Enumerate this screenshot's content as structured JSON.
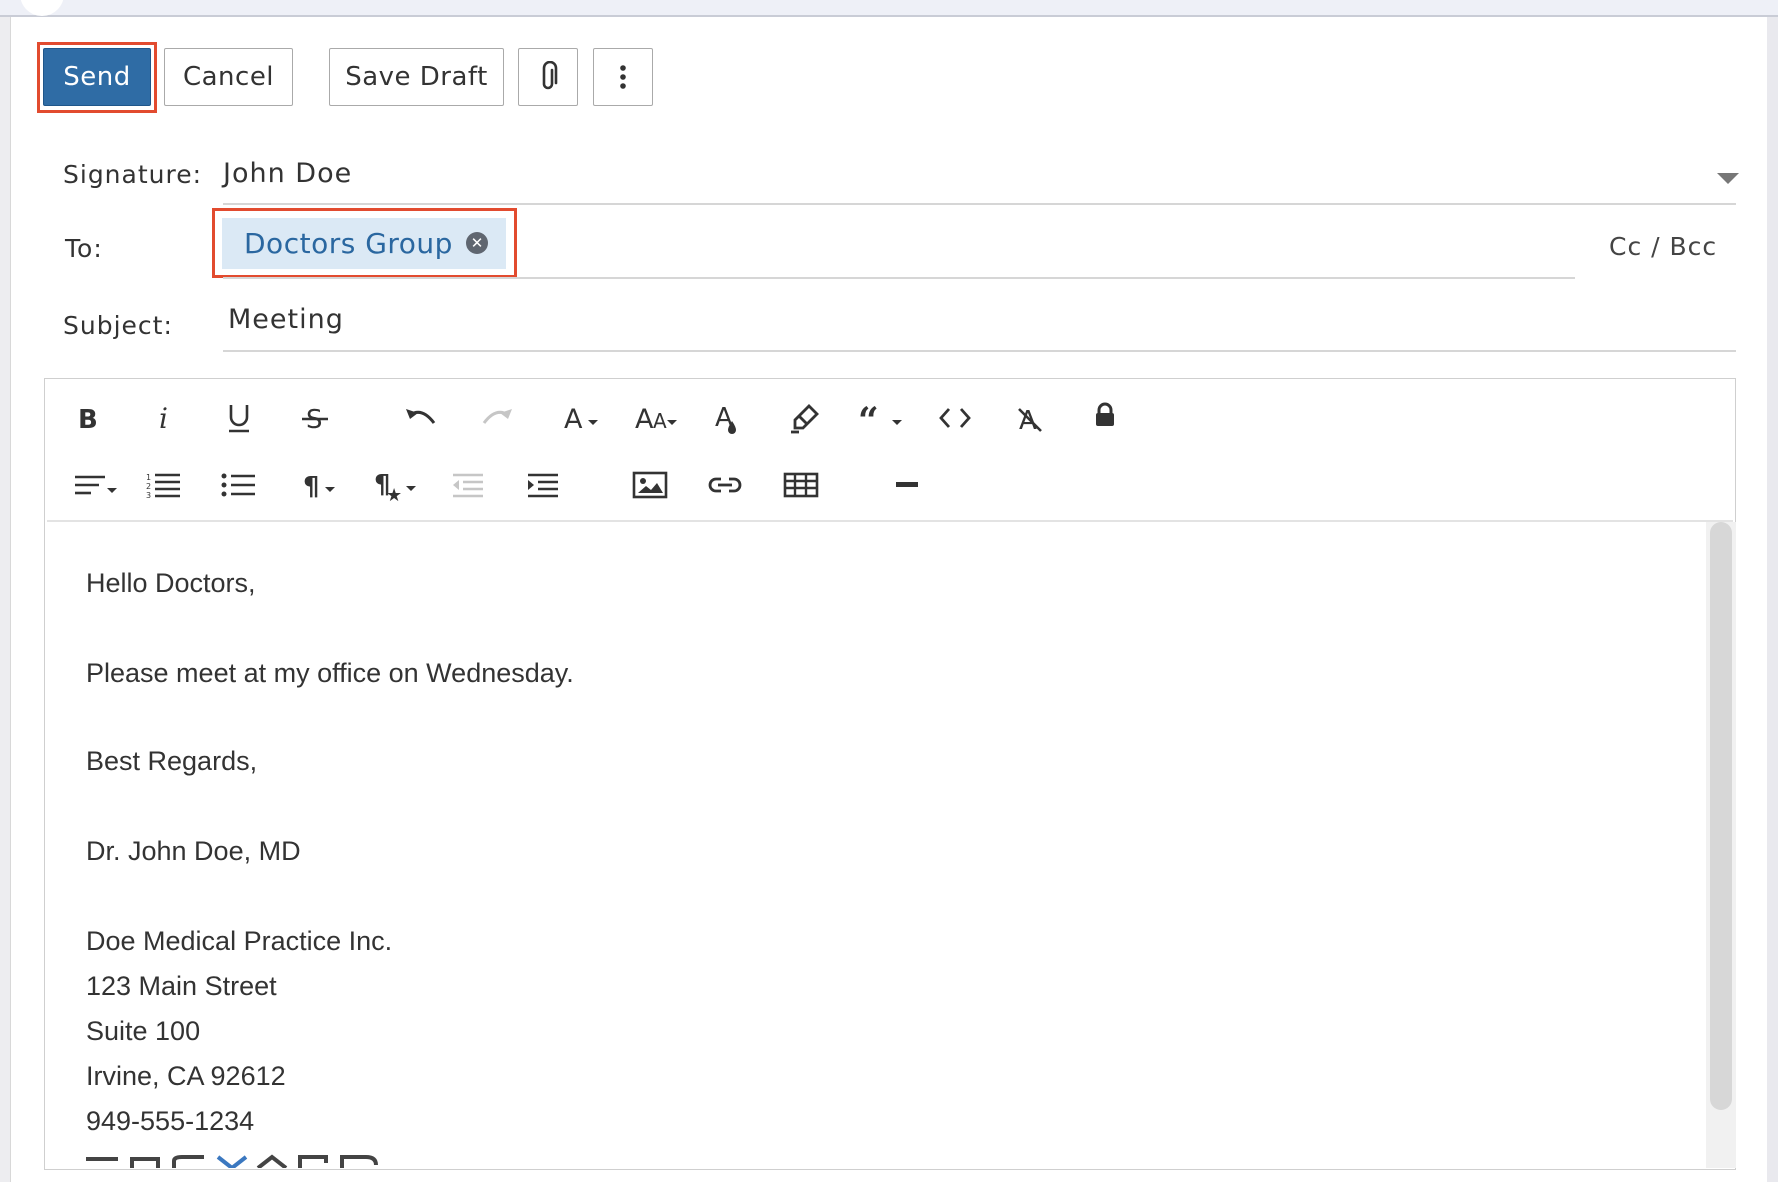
{
  "toolbar": {
    "send_label": "Send",
    "cancel_label": "Cancel",
    "save_draft_label": "Save Draft",
    "attach_icon": "paperclip-icon",
    "more_icon": "vertical-ellipsis-icon"
  },
  "form": {
    "signature_label": "Signature:",
    "signature_value": "John Doe",
    "to_label": "To:",
    "to_recipient": "Doctors Group",
    "cc_bcc_label": "Cc / Bcc",
    "subject_label": "Subject:",
    "subject_value": "Meeting"
  },
  "editor_toolbar": {
    "row1": [
      "bold-icon",
      "italic-icon",
      "underline-icon",
      "strikethrough-icon",
      "undo-icon",
      "redo-icon",
      "font-family-icon",
      "font-size-icon",
      "font-color-icon",
      "highlight-icon",
      "quote-icon",
      "code-icon",
      "clear-format-icon",
      "lock-icon"
    ],
    "row2": [
      "align-icon",
      "ordered-list-icon",
      "unordered-list-icon",
      "paragraph-format-icon",
      "paragraph-style-icon",
      "outdent-icon",
      "indent-icon",
      "insert-image-icon",
      "insert-link-icon",
      "insert-table-icon",
      "horizontal-rule-icon"
    ]
  },
  "message": {
    "greeting": "Hello Doctors,",
    "body": "Please meet at my office on Wednesday.",
    "closing": "Best Regards,",
    "sender": "Dr. John Doe, MD",
    "company": "Doe Medical Practice Inc.",
    "street": "123 Main Street",
    "suite": "Suite 100",
    "city": "Irvine, CA 92612",
    "phone": "949-555-1234"
  },
  "colors": {
    "accent": "#2f6ca5",
    "highlight_border": "#e24b2f",
    "chip_bg": "#dbe9f5"
  }
}
